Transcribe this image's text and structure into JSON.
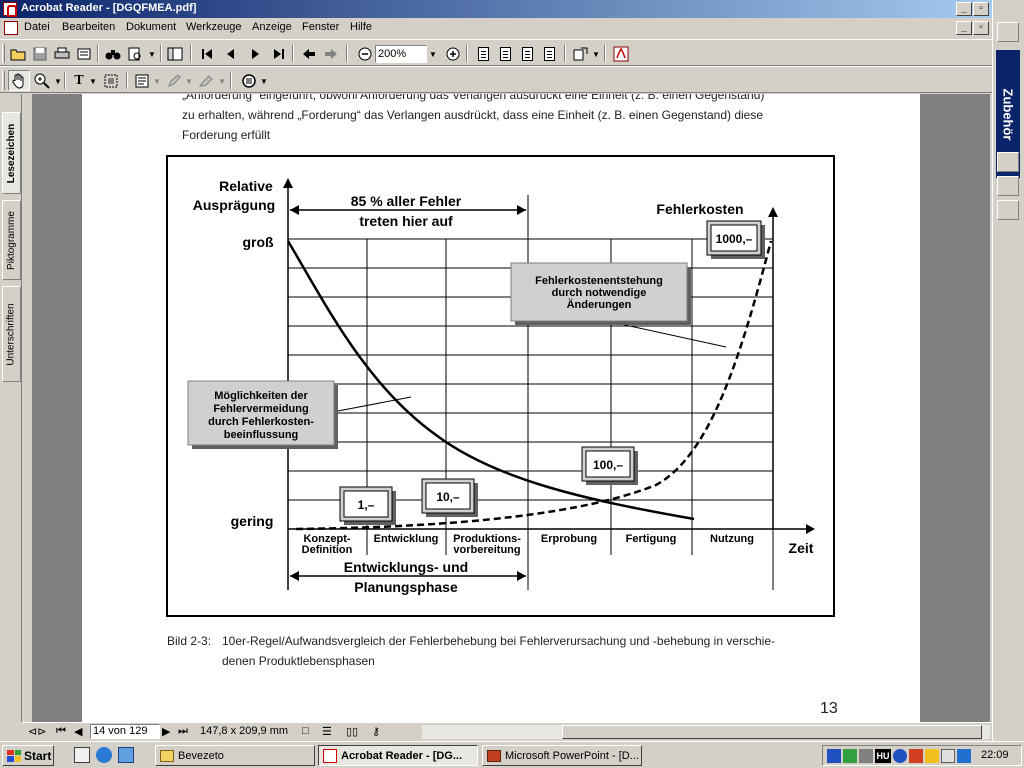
{
  "window": {
    "title": "Acrobat Reader - [DGQFMEA.pdf]"
  },
  "menu": {
    "items": [
      "Datei",
      "Bearbeiten",
      "Dokument",
      "Werkzeuge",
      "Anzeige",
      "Fenster",
      "Hilfe"
    ]
  },
  "toolbar": {
    "zoom_value": "200%"
  },
  "nav_tabs": {
    "bookmarks": "Lesezeichen",
    "thumbnails": "Piktogramme",
    "signatures": "Unterschriften"
  },
  "right_panel": {
    "title": "Zubehör"
  },
  "document": {
    "intro_line1": "„Anforderung“ eingeführt, obwohl Anforderung das Verlangen ausdrückt eine Einheit (z. B. einen Gegenstand)",
    "intro_line2": "zu erhalten, während „Forderung“ das Verlangen ausdrückt, dass eine Einheit (z. B. einen Gegenstand) diese",
    "intro_line3": "Forderung erfüllt",
    "caption_label": "Bild 2-3:",
    "caption_line1": "10er-Regel/Aufwandsvergleich der Fehlerbehebung bei Fehlerverursachung und -behebung in verschie-",
    "caption_line2": "denen Produktlebensphasen",
    "page_number": "13"
  },
  "figure": {
    "y_title_1": "Relative",
    "y_title_2": "Ausprägung",
    "y_high": "groß",
    "y_low": "gering",
    "x_title": "Zeit",
    "cost_title": "Fehlerkosten",
    "top_span_1": "85 % aller Fehler",
    "top_span_2": "treten hier auf",
    "bottom_span_1": "Entwicklungs- und",
    "bottom_span_2": "Planungsphase",
    "phases": [
      "Konzept-\nDefinition",
      "Entwicklung",
      "Produktions-\nvorbereitung",
      "Erprobung",
      "Fertigung",
      "Nutzung"
    ],
    "note_cost_1": "Fehlerkostenentstehung",
    "note_cost_2": "durch notwendige",
    "note_cost_3": "Änderungen",
    "note_avoid_1": "Möglichkeiten der",
    "note_avoid_2": "Fehlervermeidung",
    "note_avoid_3": "durch Fehlerkosten-",
    "note_avoid_4": "beeinflussung",
    "cost_labels": [
      "1,–",
      "10,–",
      "100,–",
      "1000,–"
    ]
  },
  "statusbar": {
    "page_field": "14 von 129",
    "page_size": "147,8 x 209,9 mm"
  },
  "taskbar": {
    "start": "Start",
    "buttons": [
      "Bevezeto",
      "Acrobat Reader - [DG...",
      "Microsoft PowerPoint - [D..."
    ],
    "lang": "HU",
    "clock": "22:09"
  }
}
